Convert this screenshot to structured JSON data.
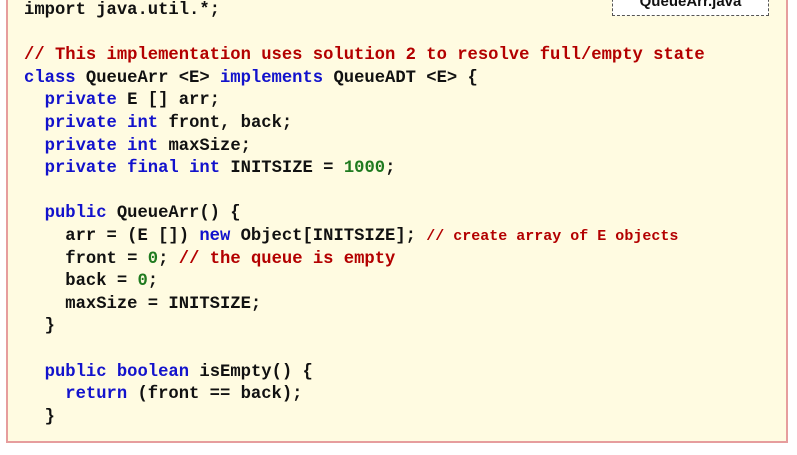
{
  "file_tab": "QueueArr.java",
  "code": {
    "lines": [
      [
        {
          "t": "import java.util.*;",
          "c": "plain"
        }
      ],
      [],
      [
        {
          "t": "// This implementation uses solution 2 to resolve full/empty state",
          "c": "cm"
        }
      ],
      [
        {
          "t": "class",
          "c": "kw"
        },
        {
          "t": " QueueArr <E> ",
          "c": "plain"
        },
        {
          "t": "implements",
          "c": "kw"
        },
        {
          "t": " QueueADT <E> {",
          "c": "plain"
        }
      ],
      [
        {
          "t": "  ",
          "c": "plain"
        },
        {
          "t": "private",
          "c": "kw"
        },
        {
          "t": " E [] arr;",
          "c": "plain"
        }
      ],
      [
        {
          "t": "  ",
          "c": "plain"
        },
        {
          "t": "private",
          "c": "kw"
        },
        {
          "t": " ",
          "c": "plain"
        },
        {
          "t": "int",
          "c": "kw"
        },
        {
          "t": " front, back;",
          "c": "plain"
        }
      ],
      [
        {
          "t": "  ",
          "c": "plain"
        },
        {
          "t": "private",
          "c": "kw"
        },
        {
          "t": " ",
          "c": "plain"
        },
        {
          "t": "int",
          "c": "kw"
        },
        {
          "t": " maxSize;",
          "c": "plain"
        }
      ],
      [
        {
          "t": "  ",
          "c": "plain"
        },
        {
          "t": "private",
          "c": "kw"
        },
        {
          "t": " ",
          "c": "plain"
        },
        {
          "t": "final",
          "c": "kw"
        },
        {
          "t": " ",
          "c": "plain"
        },
        {
          "t": "int",
          "c": "kw"
        },
        {
          "t": " INITSIZE = ",
          "c": "plain"
        },
        {
          "t": "1000",
          "c": "num"
        },
        {
          "t": ";",
          "c": "plain"
        }
      ],
      [],
      [
        {
          "t": "  ",
          "c": "plain"
        },
        {
          "t": "public",
          "c": "kw"
        },
        {
          "t": " QueueArr() {",
          "c": "plain"
        }
      ],
      [
        {
          "t": "    arr = (E []) ",
          "c": "plain"
        },
        {
          "t": "new",
          "c": "kw"
        },
        {
          "t": " Object[INITSIZE]; ",
          "c": "plain"
        },
        {
          "t": "// create array of E objects",
          "c": "cm-sm"
        }
      ],
      [
        {
          "t": "    front = ",
          "c": "plain"
        },
        {
          "t": "0",
          "c": "num"
        },
        {
          "t": "; ",
          "c": "plain"
        },
        {
          "t": "// the queue is empty",
          "c": "cm"
        }
      ],
      [
        {
          "t": "    back = ",
          "c": "plain"
        },
        {
          "t": "0",
          "c": "num"
        },
        {
          "t": ";",
          "c": "plain"
        }
      ],
      [
        {
          "t": "    maxSize = INITSIZE;",
          "c": "plain"
        }
      ],
      [
        {
          "t": "  }",
          "c": "plain"
        }
      ],
      [],
      [
        {
          "t": "  ",
          "c": "plain"
        },
        {
          "t": "public",
          "c": "kw"
        },
        {
          "t": " ",
          "c": "plain"
        },
        {
          "t": "boolean",
          "c": "kw"
        },
        {
          "t": " isEmpty() {",
          "c": "plain"
        }
      ],
      [
        {
          "t": "    ",
          "c": "plain"
        },
        {
          "t": "return",
          "c": "kw"
        },
        {
          "t": " (front == back);",
          "c": "plain"
        }
      ],
      [
        {
          "t": "  }",
          "c": "plain"
        }
      ]
    ]
  }
}
